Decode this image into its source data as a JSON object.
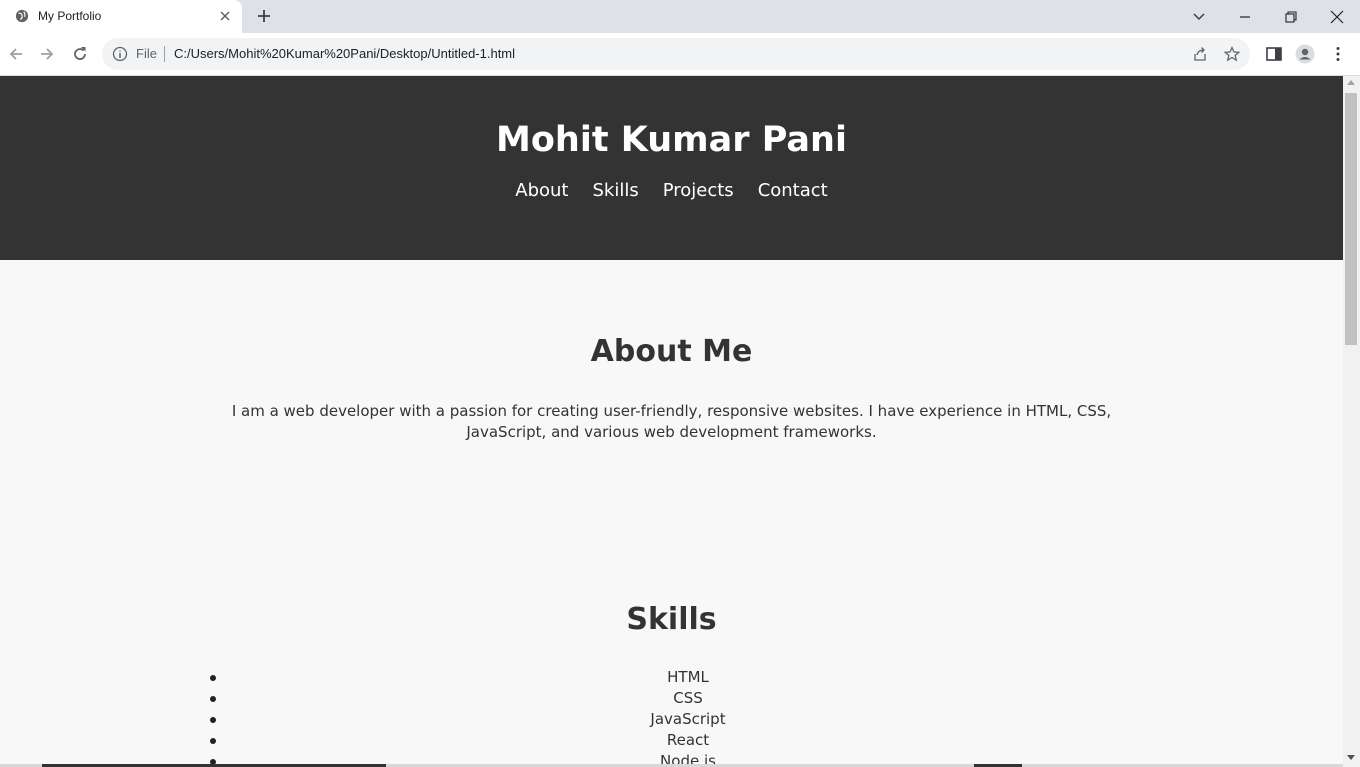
{
  "browser": {
    "tab_title": "My Portfolio",
    "omnibox_scheme": "File",
    "url": "C:/Users/Mohit%20Kumar%20Pani/Desktop/Untitled-1.html"
  },
  "page": {
    "site_title": "Mohit Kumar Pani",
    "nav": [
      "About",
      "Skills",
      "Projects",
      "Contact"
    ],
    "about": {
      "heading": "About Me",
      "text": "I am a web developer with a passion for creating user-friendly, responsive websites. I have experience in HTML, CSS, JavaScript, and various web development frameworks."
    },
    "skills": {
      "heading": "Skills",
      "items": [
        "HTML",
        "CSS",
        "JavaScript",
        "React",
        "Node.js"
      ]
    }
  },
  "colors": {
    "header_bg": "#333333",
    "page_bg": "#f8f8f8",
    "text": "#333333"
  }
}
